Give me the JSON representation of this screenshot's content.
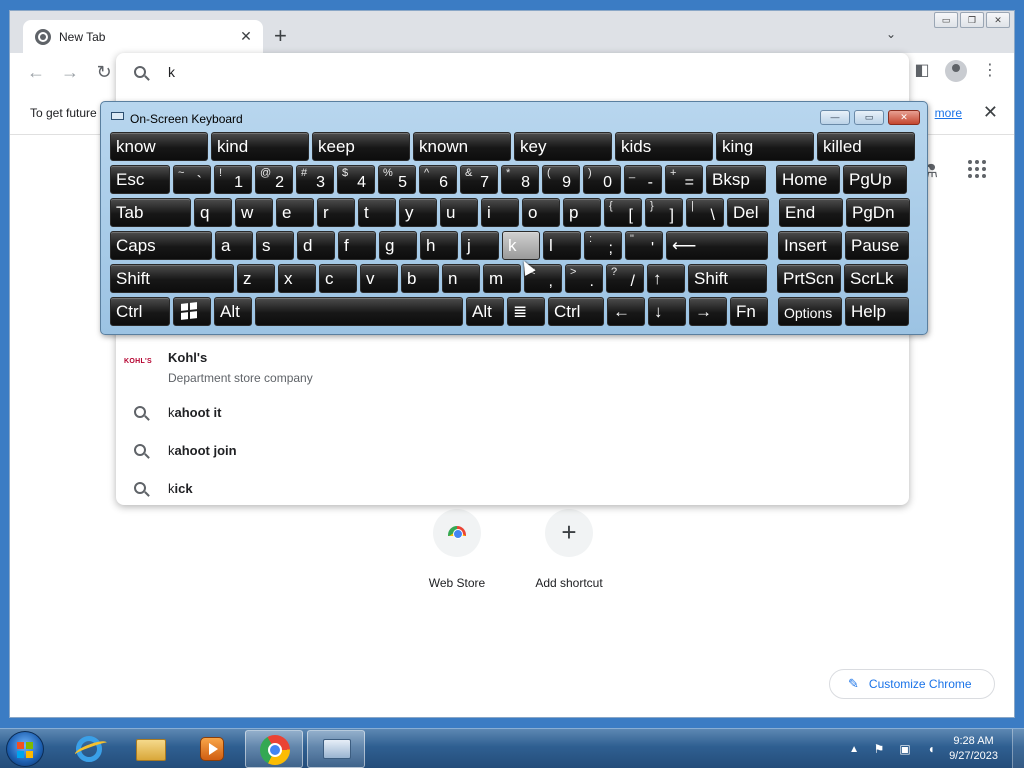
{
  "browser": {
    "tab_title": "New Tab",
    "tab_close": "✕",
    "new_tab": "+",
    "tab_search": "⌄",
    "win_minimize": "▭",
    "win_restore": "❐",
    "win_close": "✕",
    "nav": {
      "back": "←",
      "forward": "→",
      "reload": "↻"
    },
    "omnibox_value": "k",
    "side_panel": "◧",
    "menu": "⋮",
    "infobar": {
      "message": "To get future",
      "link": "more",
      "close": "✕"
    }
  },
  "suggestions": {
    "entity": {
      "logo": "KOHĽS",
      "prefix": "K",
      "rest": "ohl's",
      "description": "Department store company"
    },
    "items": [
      {
        "prefix": "k",
        "rest": "ahoot it"
      },
      {
        "prefix": "k",
        "rest": "ahoot join"
      },
      {
        "prefix": "k",
        "rest": "ick"
      }
    ]
  },
  "ntp": {
    "shortcuts": [
      {
        "label": "Web Store"
      },
      {
        "label": "Add shortcut",
        "icon": "+"
      }
    ],
    "customize": "Customize Chrome",
    "side_icon": "⚗",
    "apps_icon": "apps-grid-icon"
  },
  "osk": {
    "title": "On-Screen Keyboard",
    "buttons": {
      "minimize": "—",
      "restore": "▭",
      "close": "✕"
    },
    "predictions": [
      "know",
      "kind",
      "keep",
      "known",
      "key",
      "kids",
      "king",
      "killed"
    ],
    "row1": [
      {
        "main": "Esc"
      },
      {
        "hi": "~",
        "lo": "`"
      },
      {
        "hi": "!",
        "lo": "1"
      },
      {
        "hi": "@",
        "lo": "2"
      },
      {
        "hi": "#",
        "lo": "3"
      },
      {
        "hi": "$",
        "lo": "4"
      },
      {
        "hi": "%",
        "lo": "5"
      },
      {
        "hi": "^",
        "lo": "6"
      },
      {
        "hi": "&",
        "lo": "7"
      },
      {
        "hi": "*",
        "lo": "8"
      },
      {
        "hi": "(",
        "lo": "9"
      },
      {
        "hi": ")",
        "lo": "0"
      },
      {
        "hi": "_",
        "lo": "-"
      },
      {
        "hi": "+",
        "lo": "="
      },
      {
        "main": "Bksp"
      },
      {
        "main": "Home"
      },
      {
        "main": "PgUp"
      }
    ],
    "row2": [
      {
        "main": "Tab"
      },
      {
        "main": "q"
      },
      {
        "main": "w"
      },
      {
        "main": "e"
      },
      {
        "main": "r"
      },
      {
        "main": "t"
      },
      {
        "main": "y"
      },
      {
        "main": "u"
      },
      {
        "main": "i"
      },
      {
        "main": "o"
      },
      {
        "main": "p"
      },
      {
        "hi": "{",
        "lo": "["
      },
      {
        "hi": "}",
        "lo": "]"
      },
      {
        "hi": "|",
        "lo": "\\"
      },
      {
        "main": "Del"
      },
      {
        "main": "End"
      },
      {
        "main": "PgDn"
      }
    ],
    "row3": [
      {
        "main": "Caps"
      },
      {
        "main": "a"
      },
      {
        "main": "s"
      },
      {
        "main": "d"
      },
      {
        "main": "f"
      },
      {
        "main": "g"
      },
      {
        "main": "h"
      },
      {
        "main": "j"
      },
      {
        "main": "k",
        "pressed": true
      },
      {
        "main": "l"
      },
      {
        "hi": ":",
        "lo": ";"
      },
      {
        "hi": "\"",
        "lo": "'"
      },
      {
        "main": "⟵"
      },
      {
        "main": "Insert"
      },
      {
        "main": "Pause"
      }
    ],
    "row4": [
      {
        "main": "Shift"
      },
      {
        "main": "z"
      },
      {
        "main": "x"
      },
      {
        "main": "c"
      },
      {
        "main": "v"
      },
      {
        "main": "b"
      },
      {
        "main": "n"
      },
      {
        "main": "m"
      },
      {
        "hi": "<",
        "lo": ","
      },
      {
        "hi": ">",
        "lo": "."
      },
      {
        "hi": "?",
        "lo": "/"
      },
      {
        "main": "↑"
      },
      {
        "main": "Shift"
      },
      {
        "main": "PrtScn"
      },
      {
        "main": "ScrLk"
      }
    ],
    "row5": [
      {
        "main": "Ctrl"
      },
      {
        "main": "",
        "icon": "windows-logo-icon"
      },
      {
        "main": "Alt"
      },
      {
        "main": ""
      },
      {
        "main": "Alt"
      },
      {
        "main": "≣"
      },
      {
        "main": "Ctrl"
      },
      {
        "main": "←"
      },
      {
        "main": "↓"
      },
      {
        "main": "→"
      },
      {
        "main": "Fn"
      },
      {
        "main": "Options",
        "small": true
      },
      {
        "main": "Help"
      }
    ]
  },
  "taskbar": {
    "apps": [
      "internet-explorer-icon",
      "file-explorer-icon",
      "media-player-icon",
      "chrome-icon",
      "on-screen-keyboard-icon"
    ],
    "tray": {
      "expand": "▲"
    },
    "time": "9:28 AM",
    "date": "9/27/2023"
  }
}
